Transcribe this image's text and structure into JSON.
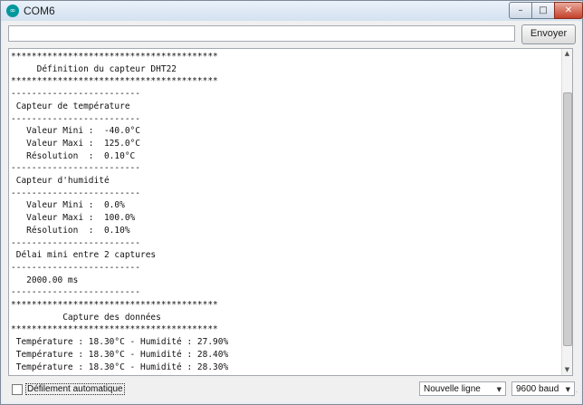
{
  "window": {
    "title": "COM6",
    "app_icon": "arduino-logo-icon",
    "minimize": "–",
    "maximize": "□",
    "close": "✕"
  },
  "send": {
    "input_value": "",
    "button_label": "Envoyer"
  },
  "output_lines": [
    "****************************************",
    "     Définition du capteur DHT22",
    "****************************************",
    "-------------------------",
    " Capteur de température",
    "-------------------------",
    "   Valeur Mini :  -40.0°C",
    "   Valeur Maxi :  125.0°C",
    "   Résolution  :  0.10°C",
    "-------------------------",
    " Capteur d'humidité",
    "-------------------------",
    "   Valeur Mini :  0.0%",
    "   Valeur Maxi :  100.0%",
    "   Résolution  :  0.10%",
    "-------------------------",
    " Délai mini entre 2 captures",
    "-------------------------",
    "   2000.00 ms",
    "-------------------------",
    "****************************************",
    "          Capture des données",
    "****************************************",
    " Température : 18.30°C - Humidité : 27.90%",
    " Température : 18.30°C - Humidité : 28.40%",
    " Température : 18.30°C - Humidité : 28.30%"
  ],
  "footer": {
    "autoscroll_label": "Défilement automatique",
    "autoscroll_checked": false,
    "line_ending": "Nouvelle ligne",
    "baud_rate": "9600 baud"
  }
}
